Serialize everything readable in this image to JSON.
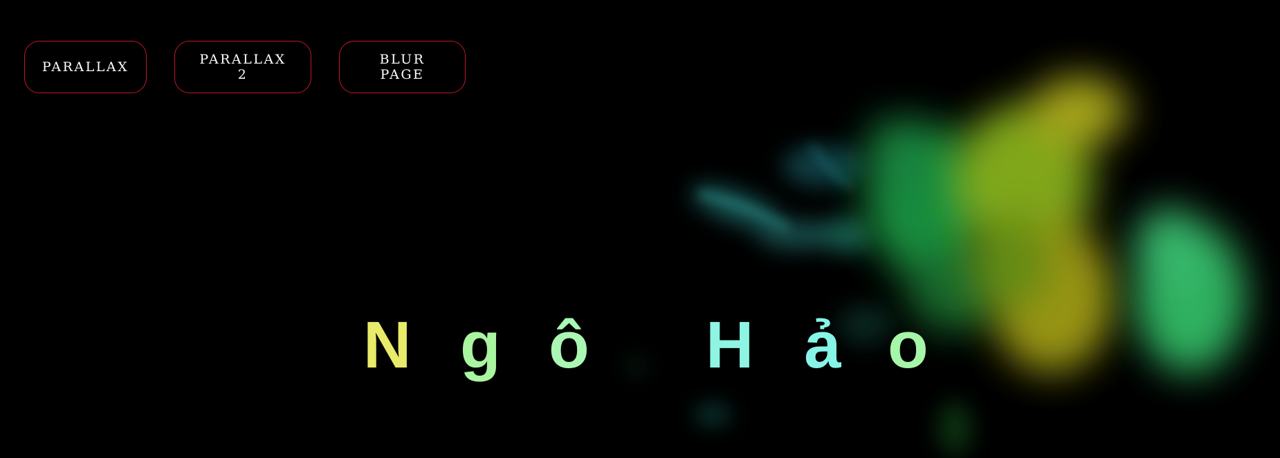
{
  "nav": {
    "items": [
      {
        "label": "PARALLAX"
      },
      {
        "label": "PARALLAX 2"
      },
      {
        "label": "BLUR PAGE"
      }
    ],
    "border_color": "#c4162a"
  },
  "hero": {
    "letters": [
      {
        "char": "N",
        "color": "#e8ea6a"
      },
      {
        "char": "g",
        "color": "#a9f5a0"
      },
      {
        "char": "ô",
        "color": "#a9f7b2"
      },
      {
        "char": "H",
        "color": "#8ef5e4"
      },
      {
        "char": "ả",
        "color": "#87f4e8"
      },
      {
        "char": "o",
        "color": "#a6f6a8"
      }
    ]
  },
  "background": {
    "color": "#000000",
    "smoke_colors": [
      "#2aa89a",
      "#28c45a",
      "#9bc21a",
      "#c2b81a",
      "#46d67a"
    ]
  }
}
